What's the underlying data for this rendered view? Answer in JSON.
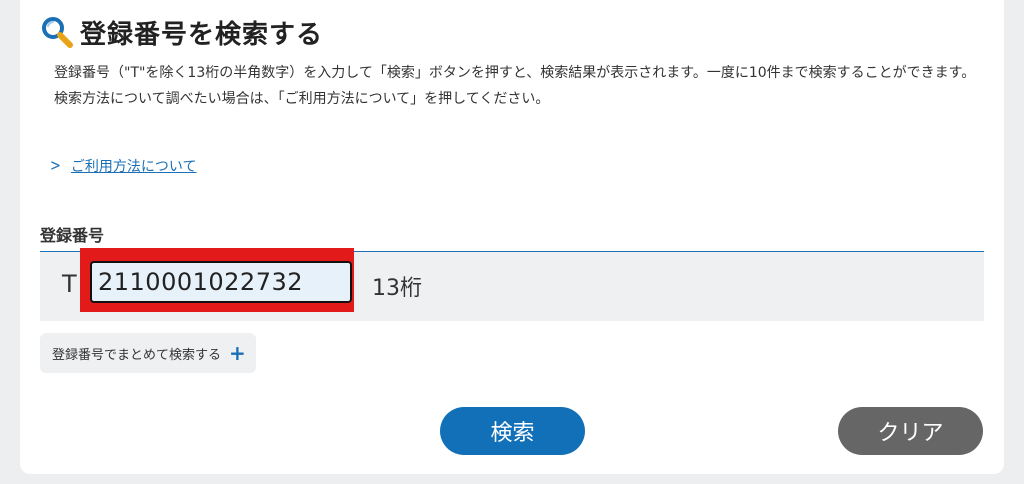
{
  "header": {
    "title": "登録番号を検索する",
    "icon": "magnifier-icon"
  },
  "description": {
    "line1": "登録番号（\"T\"を除く13桁の半角数字）を入力して「検索」ボタンを押すと、検索結果が表示されます。一度に10件まで検索することができます。",
    "line2": "検索方法について調べたい場合は、「ご利用方法について」を押してください。"
  },
  "help": {
    "link_label": "ご利用方法について"
  },
  "field": {
    "label": "登録番号",
    "prefix": "T",
    "value": "2110001022732",
    "digits_hint": "13桁"
  },
  "bulk": {
    "label": "登録番号でまとめて検索する",
    "icon": "plus-icon"
  },
  "actions": {
    "search_label": "検索",
    "clear_label": "クリア"
  },
  "colors": {
    "accent": "#1270b9",
    "clear": "#666666",
    "highlight": "#e21a1a",
    "input_bg": "#e7f1fa"
  }
}
